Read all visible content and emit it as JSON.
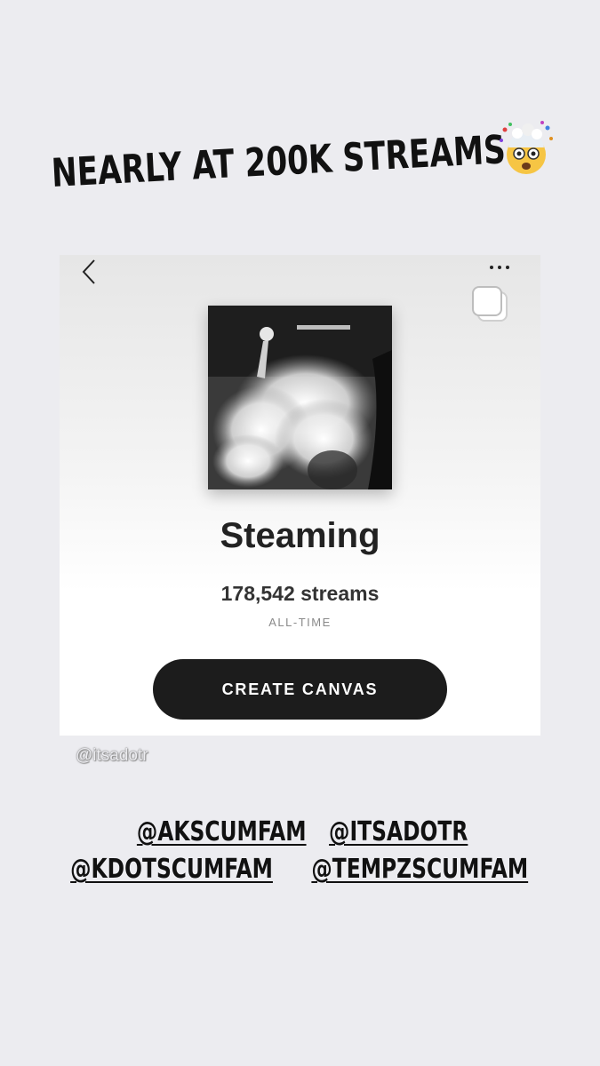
{
  "story": {
    "headline": "NEARLY AT 200K STREAMS",
    "headline_emoji": "exploding-head-emoji",
    "watermark": "@itsadotr",
    "tags": [
      [
        "@AKSCUMFAM",
        "@ITSADOTR"
      ],
      [
        "@KDOTSCUMFAM",
        "@TEMPZSCUMFAM"
      ]
    ]
  },
  "card": {
    "song_title": "Steaming",
    "stream_count": "178,542 streams",
    "period": "ALL-TIME",
    "cta_label": "CREATE CANVAS",
    "icons": {
      "back": "chevron-left-icon",
      "more": "more-dots-icon",
      "overlay": "stack-icon"
    }
  }
}
